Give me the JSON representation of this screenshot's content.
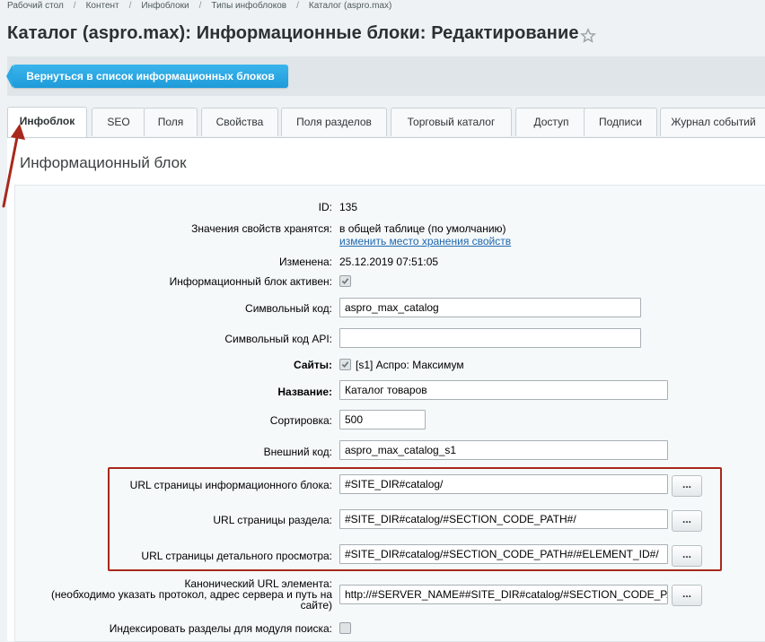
{
  "breadcrumb": [
    "Рабочий стол",
    "Контент",
    "Инфоблоки",
    "Типы инфоблоков",
    "Каталог (aspro.max)"
  ],
  "page_title": "Каталог (aspro.max): Информационные блоки: Редактирование",
  "back_button": "Вернуться в список информационных блоков",
  "tabs": [
    "Инфоблок",
    "SEO",
    "Поля",
    "Свойства",
    "Поля разделов",
    "Торговый каталог",
    "Доступ",
    "Подписи",
    "Журнал событий"
  ],
  "active_tab": "Инфоблок",
  "section_title": "Информационный блок",
  "form": {
    "id_label": "ID:",
    "id_value": "135",
    "storage_label": "Значения свойств хранятся:",
    "storage_value": "в общей таблице (по умолчанию)",
    "storage_link": "изменить место хранения свойств",
    "modified_label": "Изменена:",
    "modified_value": "25.12.2019 07:51:05",
    "active_label": "Информационный блок активен:",
    "code_label": "Символьный код:",
    "code_value": "aspro_max_catalog",
    "api_code_label": "Символьный код API:",
    "api_code_value": "",
    "sites_label": "Сайты:",
    "sites_value": "[s1] Аспро: Максимум",
    "name_label": "Название:",
    "name_value": "Каталог товаров",
    "sort_label": "Сортировка:",
    "sort_value": "500",
    "external_code_label": "Внешний код:",
    "external_code_value": "aspro_max_catalog_s1",
    "list_url_label": "URL страницы информационного блока:",
    "list_url_value": "#SITE_DIR#catalog/",
    "section_url_label": "URL страницы раздела:",
    "section_url_value": "#SITE_DIR#catalog/#SECTION_CODE_PATH#/",
    "detail_url_label": "URL страницы детального просмотра:",
    "detail_url_value": "#SITE_DIR#catalog/#SECTION_CODE_PATH#/#ELEMENT_ID#/",
    "canonical_label_1": "Канонический URL элемента:",
    "canonical_label_2": "(необходимо указать протокол, адрес сервера и путь на",
    "canonical_label_3": "сайте)",
    "canonical_value": "http://#SERVER_NAME##SITE_DIR#catalog/#SECTION_CODE_PA",
    "index_sections_label": "Индексировать разделы для модуля поиска:",
    "dots": "..."
  },
  "colors": {
    "accent": "#1e9bd9",
    "highlight": "#a8281c",
    "link": "#2067b0"
  }
}
